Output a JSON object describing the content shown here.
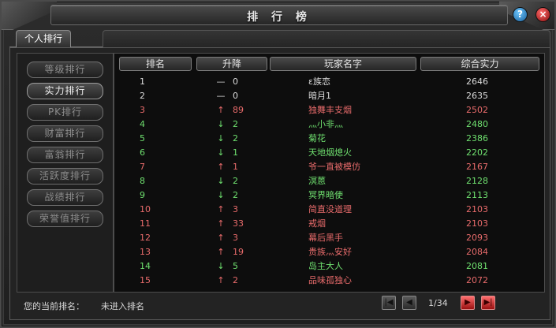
{
  "window": {
    "title": "排 行 榜"
  },
  "header_buttons": {
    "help": "?",
    "close": "×"
  },
  "tabs": [
    {
      "label": "个人排行",
      "active": true
    }
  ],
  "sidebar": {
    "items": [
      {
        "label": "等级排行",
        "active": false
      },
      {
        "label": "实力排行",
        "active": true
      },
      {
        "label": "PK排行",
        "active": false
      },
      {
        "label": "财富排行",
        "active": false
      },
      {
        "label": "富翁排行",
        "active": false
      },
      {
        "label": "活跃度排行",
        "active": false
      },
      {
        "label": "战绩排行",
        "active": false
      },
      {
        "label": "荣誉值排行",
        "active": false
      }
    ]
  },
  "table": {
    "columns": [
      "排名",
      "升降",
      "玩家名字",
      "综合实力"
    ],
    "rows": [
      {
        "rank": "1",
        "arrow": "—",
        "change": "0",
        "name": "ε族恋",
        "power": "2646",
        "color": "white"
      },
      {
        "rank": "2",
        "arrow": "—",
        "change": "0",
        "name": "暗月1",
        "power": "2635",
        "color": "white"
      },
      {
        "rank": "3",
        "arrow": "↑",
        "change": "89",
        "name": "独舞丰支烟",
        "power": "2502",
        "color": "red"
      },
      {
        "rank": "4",
        "arrow": "↓",
        "change": "2",
        "name": "灬小非灬",
        "power": "2480",
        "color": "green"
      },
      {
        "rank": "5",
        "arrow": "↓",
        "change": "2",
        "name": "菊花",
        "power": "2386",
        "color": "green"
      },
      {
        "rank": "6",
        "arrow": "↓",
        "change": "1",
        "name": "天地烟熄火",
        "power": "2202",
        "color": "green"
      },
      {
        "rank": "7",
        "arrow": "↑",
        "change": "1",
        "name": "爷一直被模仿",
        "power": "2167",
        "color": "red"
      },
      {
        "rank": "8",
        "arrow": "↓",
        "change": "2",
        "name": "溟蒽",
        "power": "2128",
        "color": "green"
      },
      {
        "rank": "9",
        "arrow": "↓",
        "change": "2",
        "name": "冥界暗使",
        "power": "2113",
        "color": "green"
      },
      {
        "rank": "10",
        "arrow": "↑",
        "change": "3",
        "name": "简直没道理",
        "power": "2103",
        "color": "red"
      },
      {
        "rank": "11",
        "arrow": "↑",
        "change": "33",
        "name": "戒烟",
        "power": "2103",
        "color": "red"
      },
      {
        "rank": "12",
        "arrow": "↑",
        "change": "3",
        "name": "幕后黑手",
        "power": "2093",
        "color": "red"
      },
      {
        "rank": "13",
        "arrow": "↑",
        "change": "19",
        "name": "贵族灬安好",
        "power": "2084",
        "color": "red"
      },
      {
        "rank": "14",
        "arrow": "↓",
        "change": "5",
        "name": "岛主大人",
        "power": "2081",
        "color": "green"
      },
      {
        "rank": "15",
        "arrow": "↑",
        "change": "2",
        "name": "品味孤独心",
        "power": "2072",
        "color": "red"
      }
    ]
  },
  "footer": {
    "current_rank_label": "您的当前排名：",
    "current_rank_value": "未进入排名",
    "page_indicator": "1/34"
  },
  "colors": {
    "rise": "#e86b6b",
    "fall": "#6fe06f",
    "neutral": "#dcdcdc"
  }
}
